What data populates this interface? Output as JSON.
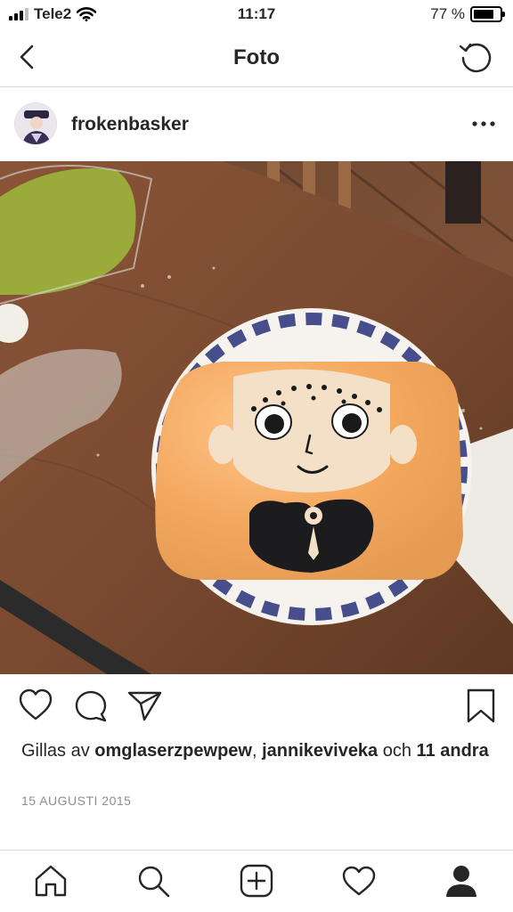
{
  "status_bar": {
    "carrier": "Tele2",
    "time": "11:17",
    "battery_text": "77 %",
    "battery_level": 0.77
  },
  "nav": {
    "title": "Foto",
    "back_icon": "chevron-left-icon",
    "refresh_icon": "refresh-icon"
  },
  "post": {
    "username": "frokenbasker",
    "more_icon": "more-horizontal-icon",
    "image_icon": "photo-cake-with-face"
  },
  "actions": {
    "like_icon": "heart-outline-icon",
    "comment_icon": "comment-icon",
    "share_icon": "send-icon",
    "save_icon": "bookmark-icon"
  },
  "likes": {
    "prefix": "Gillas av ",
    "user1": "omglaserzpewpew",
    "separator": ", ",
    "user2": "jannikeviveka",
    "conj": " och ",
    "others": "11 andra"
  },
  "date": "15 AUGUSTI 2015",
  "tab_bar": {
    "items": [
      "home-icon",
      "search-icon",
      "new-post-icon",
      "activity-icon",
      "profile-icon"
    ]
  }
}
